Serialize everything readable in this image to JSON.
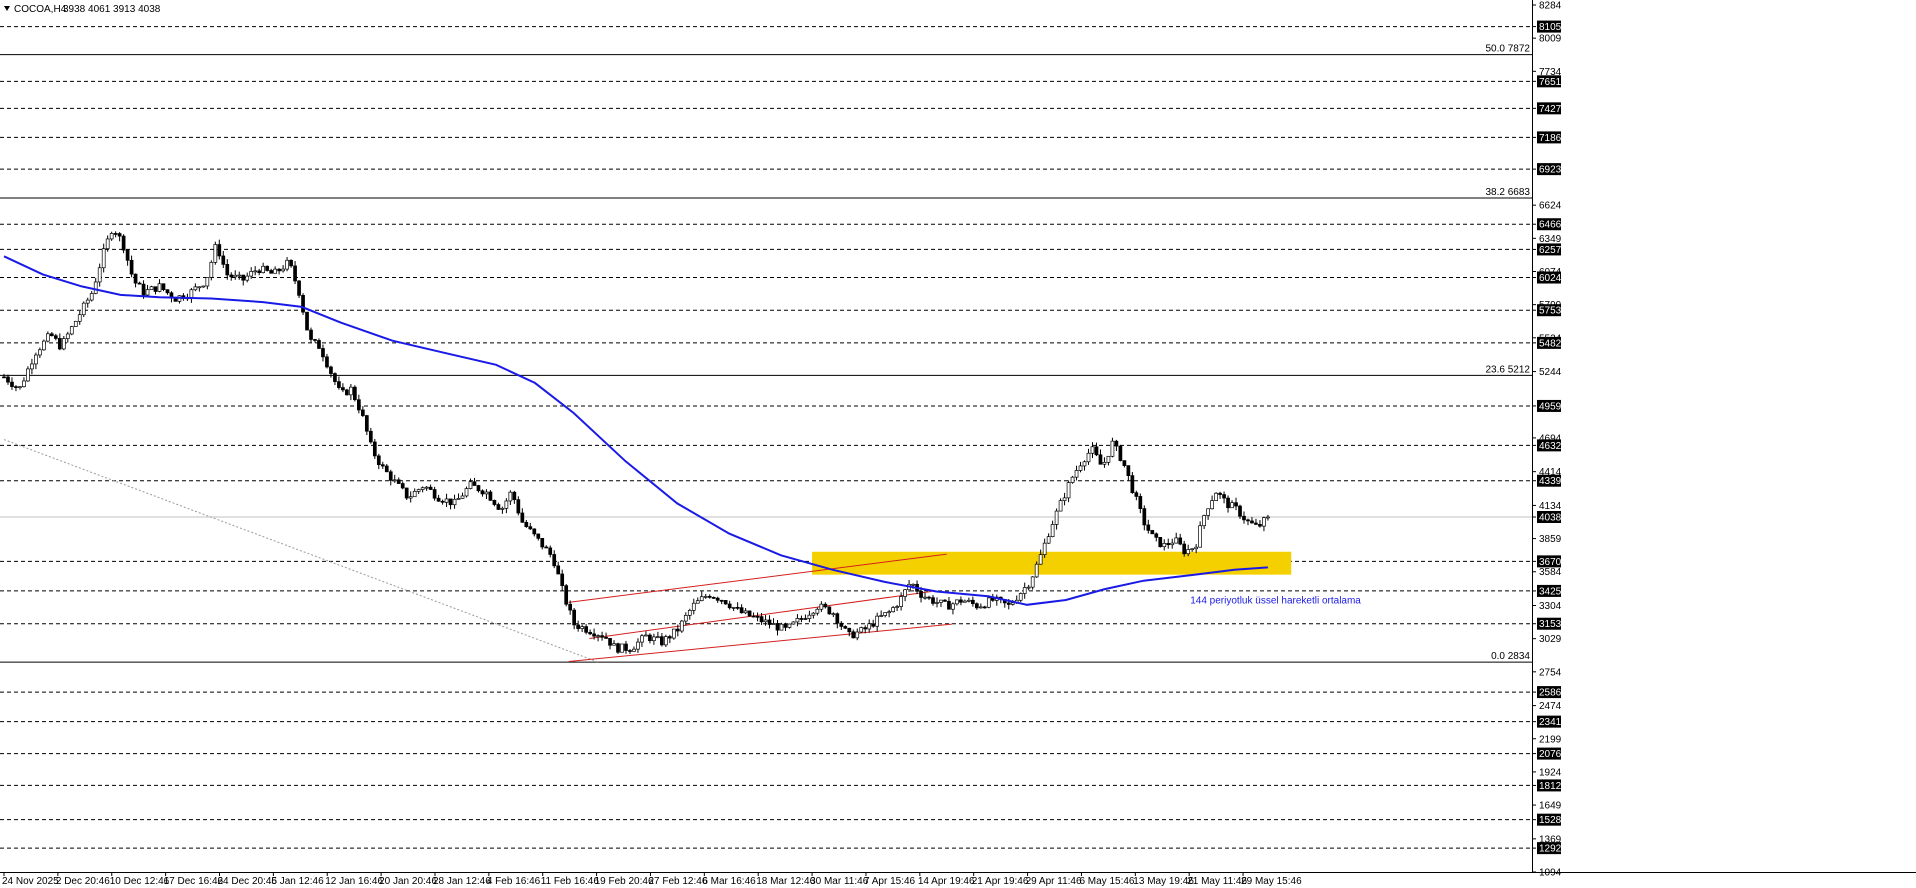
{
  "header": {
    "symbol": "COCOA,H4",
    "ohlc": "3938 4061 3913 4038"
  },
  "colors": {
    "background": "#ffffff",
    "grid": "#000000",
    "ema": "#1a1ae6",
    "channel": "#d42020",
    "zone": "#f5d000",
    "candle_bull": "#ffffff",
    "candle_bear": "#000000",
    "current_price_line": "#c0c0c0",
    "annotation": "#1a1ae6"
  },
  "chart_data": {
    "type": "candlestick",
    "instrument": "COCOA",
    "timeframe": "H4",
    "ylim": [
      1094,
      8284
    ],
    "current_price": 4038,
    "price_axis_labels": [
      {
        "value": 8284,
        "highlighted": false
      },
      {
        "value": 8105,
        "highlighted": true
      },
      {
        "value": 8009,
        "highlighted": false
      },
      {
        "value": 7734,
        "highlighted": false
      },
      {
        "value": 7651,
        "highlighted": true
      },
      {
        "value": 7427,
        "highlighted": true
      },
      {
        "value": 7186,
        "highlighted": true
      },
      {
        "value": 6923,
        "highlighted": true
      },
      {
        "value": 6624,
        "highlighted": false
      },
      {
        "value": 6466,
        "highlighted": true
      },
      {
        "value": 6349,
        "highlighted": false
      },
      {
        "value": 6257,
        "highlighted": true
      },
      {
        "value": 6074,
        "highlighted": false
      },
      {
        "value": 6024,
        "highlighted": true
      },
      {
        "value": 5799,
        "highlighted": false
      },
      {
        "value": 5753,
        "highlighted": true
      },
      {
        "value": 5524,
        "highlighted": false
      },
      {
        "value": 5482,
        "highlighted": true
      },
      {
        "value": 5244,
        "highlighted": false
      },
      {
        "value": 4959,
        "highlighted": true
      },
      {
        "value": 4694,
        "highlighted": false
      },
      {
        "value": 4632,
        "highlighted": true
      },
      {
        "value": 4414,
        "highlighted": false
      },
      {
        "value": 4339,
        "highlighted": true
      },
      {
        "value": 4134,
        "highlighted": false
      },
      {
        "value": 4038,
        "highlighted": true
      },
      {
        "value": 3859,
        "highlighted": false
      },
      {
        "value": 3670,
        "highlighted": true
      },
      {
        "value": 3584,
        "highlighted": false
      },
      {
        "value": 3425,
        "highlighted": true
      },
      {
        "value": 3304,
        "highlighted": false
      },
      {
        "value": 3153,
        "highlighted": true
      },
      {
        "value": 3029,
        "highlighted": false
      },
      {
        "value": 2754,
        "highlighted": false
      },
      {
        "value": 2586,
        "highlighted": true
      },
      {
        "value": 2474,
        "highlighted": false
      },
      {
        "value": 2341,
        "highlighted": true
      },
      {
        "value": 2199,
        "highlighted": false
      },
      {
        "value": 2076,
        "highlighted": true
      },
      {
        "value": 1924,
        "highlighted": false
      },
      {
        "value": 1812,
        "highlighted": true
      },
      {
        "value": 1649,
        "highlighted": false
      },
      {
        "value": 1528,
        "highlighted": true
      },
      {
        "value": 1369,
        "highlighted": false
      },
      {
        "value": 1292,
        "highlighted": true
      },
      {
        "value": 1094,
        "highlighted": false
      }
    ],
    "dashed_levels": [
      8105,
      7651,
      7427,
      7186,
      6923,
      6466,
      6257,
      6024,
      5753,
      5482,
      4959,
      4632,
      4339,
      3670,
      3425,
      3153,
      2586,
      2341,
      2076,
      1812,
      1528,
      1292
    ],
    "fibonacci_levels": [
      {
        "label": "50.0 7872",
        "value": 7872
      },
      {
        "label": "38.2 6683",
        "value": 6683
      },
      {
        "label": "23.6 5212",
        "value": 5212
      },
      {
        "label": "0.0 2834",
        "value": 2834
      }
    ],
    "x_tick_labels": [
      "24 Nov 2025",
      "2 Dec 20:46",
      "10 Dec 12:46",
      "17 Dec 16:46",
      "24 Dec 20:46",
      "5 Jan 12:46",
      "12 Jan 16:46",
      "20 Jan 20:46",
      "28 Jan 12:46",
      "4 Feb 16:46",
      "11 Feb 16:46",
      "19 Feb 20:46",
      "27 Feb 12:46",
      "6 Mar 16:46",
      "18 Mar 12:46",
      "30 Mar 11:46",
      "7 Apr 15:46",
      "14 Apr 19:46",
      "21 Apr 19:46",
      "29 Apr 11:46",
      "6 May 15:46",
      "13 May 19:46",
      "21 May 11:46",
      "29 May 15:46"
    ],
    "price_path": [
      [
        0,
        5200
      ],
      [
        0.6,
        5100
      ],
      [
        1.2,
        5400
      ],
      [
        1.8,
        5550
      ],
      [
        2.2,
        5450
      ],
      [
        2.6,
        5600
      ],
      [
        3.0,
        5750
      ],
      [
        3.4,
        5900
      ],
      [
        3.8,
        6200
      ],
      [
        4.2,
        6450
      ],
      [
        4.6,
        6300
      ],
      [
        5.0,
        6000
      ],
      [
        5.4,
        5900
      ],
      [
        6.0,
        5950
      ],
      [
        6.6,
        5850
      ],
      [
        7.2,
        5900
      ],
      [
        7.8,
        6000
      ],
      [
        8.2,
        6300
      ],
      [
        8.6,
        6050
      ],
      [
        9.2,
        6000
      ],
      [
        9.8,
        6100
      ],
      [
        10.4,
        6050
      ],
      [
        11.0,
        6150
      ],
      [
        11.4,
        5900
      ],
      [
        11.8,
        5500
      ],
      [
        12.2,
        5450
      ],
      [
        12.6,
        5250
      ],
      [
        13.0,
        5050
      ],
      [
        13.4,
        5100
      ],
      [
        13.8,
        4900
      ],
      [
        14.2,
        4600
      ],
      [
        14.6,
        4450
      ],
      [
        15.0,
        4350
      ],
      [
        15.6,
        4200
      ],
      [
        16.2,
        4300
      ],
      [
        16.8,
        4200
      ],
      [
        17.4,
        4150
      ],
      [
        18.0,
        4300
      ],
      [
        18.6,
        4250
      ],
      [
        19.2,
        4100
      ],
      [
        19.6,
        4250
      ],
      [
        20.0,
        4000
      ],
      [
        20.6,
        3850
      ],
      [
        21.2,
        3700
      ],
      [
        21.6,
        3400
      ],
      [
        22.0,
        3150
      ],
      [
        22.6,
        3100
      ],
      [
        23.2,
        3050
      ],
      [
        23.6,
        2950
      ],
      [
        24.2,
        2950
      ],
      [
        24.8,
        3050
      ],
      [
        25.4,
        3000
      ],
      [
        26.0,
        3100
      ],
      [
        26.6,
        3300
      ],
      [
        27.2,
        3400
      ],
      [
        27.8,
        3350
      ],
      [
        28.4,
        3250
      ],
      [
        29.0,
        3200
      ],
      [
        29.6,
        3150
      ],
      [
        30.2,
        3100
      ],
      [
        30.8,
        3200
      ],
      [
        31.4,
        3300
      ],
      [
        32.0,
        3250
      ],
      [
        32.6,
        3050
      ],
      [
        33.2,
        3100
      ],
      [
        33.8,
        3200
      ],
      [
        34.2,
        3250
      ],
      [
        34.6,
        3350
      ],
      [
        35.0,
        3500
      ],
      [
        35.4,
        3400
      ],
      [
        35.8,
        3350
      ],
      [
        36.4,
        3300
      ],
      [
        37.0,
        3350
      ],
      [
        37.6,
        3300
      ],
      [
        38.2,
        3350
      ],
      [
        38.8,
        3300
      ],
      [
        39.2,
        3400
      ],
      [
        39.6,
        3500
      ],
      [
        40.0,
        3700
      ],
      [
        40.4,
        3950
      ],
      [
        40.8,
        4150
      ],
      [
        41.2,
        4350
      ],
      [
        41.6,
        4500
      ],
      [
        42.0,
        4600
      ],
      [
        42.4,
        4450
      ],
      [
        42.8,
        4650
      ],
      [
        43.2,
        4500
      ],
      [
        43.6,
        4250
      ],
      [
        44.0,
        4000
      ],
      [
        44.4,
        3850
      ],
      [
        44.8,
        3800
      ],
      [
        45.2,
        3850
      ],
      [
        45.6,
        3750
      ],
      [
        46.0,
        3800
      ],
      [
        46.4,
        4100
      ],
      [
        46.8,
        4250
      ],
      [
        47.2,
        4150
      ],
      [
        47.6,
        4100
      ],
      [
        48.0,
        4000
      ],
      [
        48.4,
        3950
      ],
      [
        48.8,
        4038
      ]
    ],
    "ema_path": [
      [
        0,
        6200
      ],
      [
        1.5,
        6050
      ],
      [
        3.0,
        5950
      ],
      [
        4.5,
        5880
      ],
      [
        6.0,
        5860
      ],
      [
        8.0,
        5850
      ],
      [
        10.0,
        5820
      ],
      [
        11.5,
        5780
      ],
      [
        13.0,
        5650
      ],
      [
        15.0,
        5500
      ],
      [
        17.0,
        5400
      ],
      [
        19.0,
        5300
      ],
      [
        20.5,
        5150
      ],
      [
        22.0,
        4900
      ],
      [
        24.0,
        4500
      ],
      [
        26.0,
        4150
      ],
      [
        28.0,
        3900
      ],
      [
        30.0,
        3720
      ],
      [
        32.0,
        3600
      ],
      [
        34.0,
        3500
      ],
      [
        36.0,
        3420
      ],
      [
        38.0,
        3380
      ],
      [
        39.5,
        3310
      ],
      [
        41.0,
        3350
      ],
      [
        42.5,
        3440
      ],
      [
        44.0,
        3510
      ],
      [
        46.0,
        3560
      ],
      [
        47.5,
        3600
      ],
      [
        48.8,
        3620
      ]
    ],
    "channel_lines": [
      {
        "from": [
          21.8,
          3330
        ],
        "to": [
          36.4,
          3730
        ]
      },
      {
        "from": [
          21.8,
          2840
        ],
        "to": [
          36.6,
          3150
        ]
      },
      {
        "from": [
          22.6,
          3030
        ],
        "to": [
          35.8,
          3420
        ]
      }
    ],
    "trendline": {
      "from": [
        0,
        4680
      ],
      "to": [
        23.0,
        2830
      ]
    },
    "zone": {
      "x_start": 31.2,
      "x_end": 49.7,
      "price_low": 3560,
      "price_high": 3750
    },
    "annotations": [
      {
        "text": "144 periyotluk üssel hareketli ortalama",
        "at_index": 45.8,
        "price": 3320
      }
    ]
  }
}
